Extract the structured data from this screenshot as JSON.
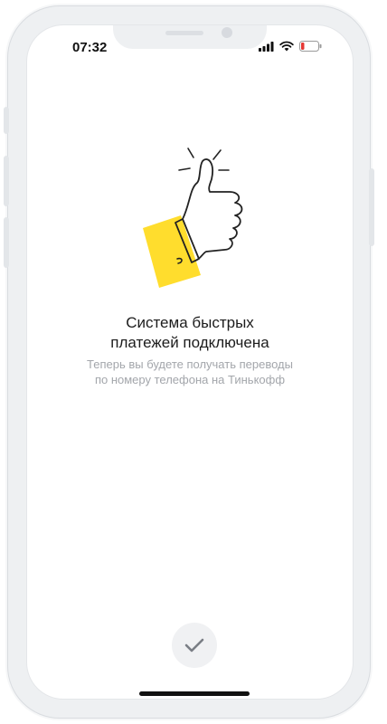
{
  "status_bar": {
    "time": "07:32",
    "icons": [
      "cellular-signal-icon",
      "wifi-icon",
      "battery-low-icon"
    ]
  },
  "content": {
    "illustration": "thumbs-up-icon",
    "title_lines": [
      "Система быстрых",
      "платежей подключена"
    ],
    "subtitle_lines": [
      "Теперь вы будете получать переводы",
      "по номеру телефона на Тинькофф"
    ]
  },
  "actions": {
    "confirm_icon": "checkmark-icon"
  },
  "colors": {
    "accent": "#FFDD2D",
    "battery": "#E53935",
    "subtitle": "#A3A6AB"
  }
}
